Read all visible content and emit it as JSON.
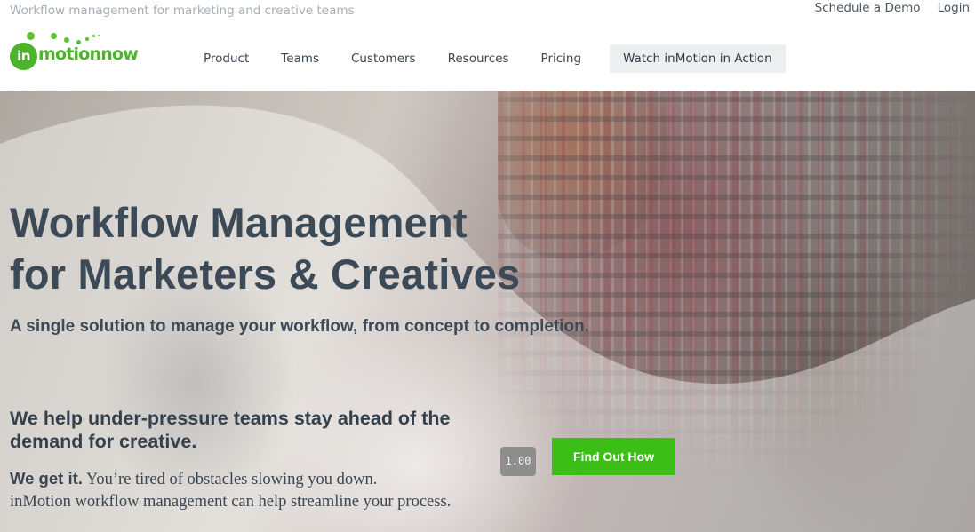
{
  "header": {
    "tagline": "Workflow management for marketing and creative teams",
    "utility": {
      "schedule": "Schedule a Demo",
      "login": "Login"
    },
    "logo": {
      "in": "in",
      "rest": "motionnow"
    },
    "nav": [
      "Product",
      "Teams",
      "Customers",
      "Resources",
      "Pricing"
    ],
    "cta": "Watch inMotion in Action"
  },
  "hero": {
    "headline_line1": "Workflow Management",
    "headline_line2": "for Marketers & Creatives",
    "subhead": "A single solution to manage your workflow, from concept to completion.",
    "pitch": "We help under-pressure teams stay ahead of the demand for creative.",
    "body_lead": "We get it.",
    "body_rest": " You’re tired of obstacles slowing you down.",
    "body_line2": "inMotion workflow management can help streamline your process.",
    "speed_badge": "1.00",
    "button": "Find Out How"
  },
  "colors": {
    "brand_green": "#4db32b",
    "button_green": "#3bbf16",
    "text_dark": "#3c4a57"
  }
}
